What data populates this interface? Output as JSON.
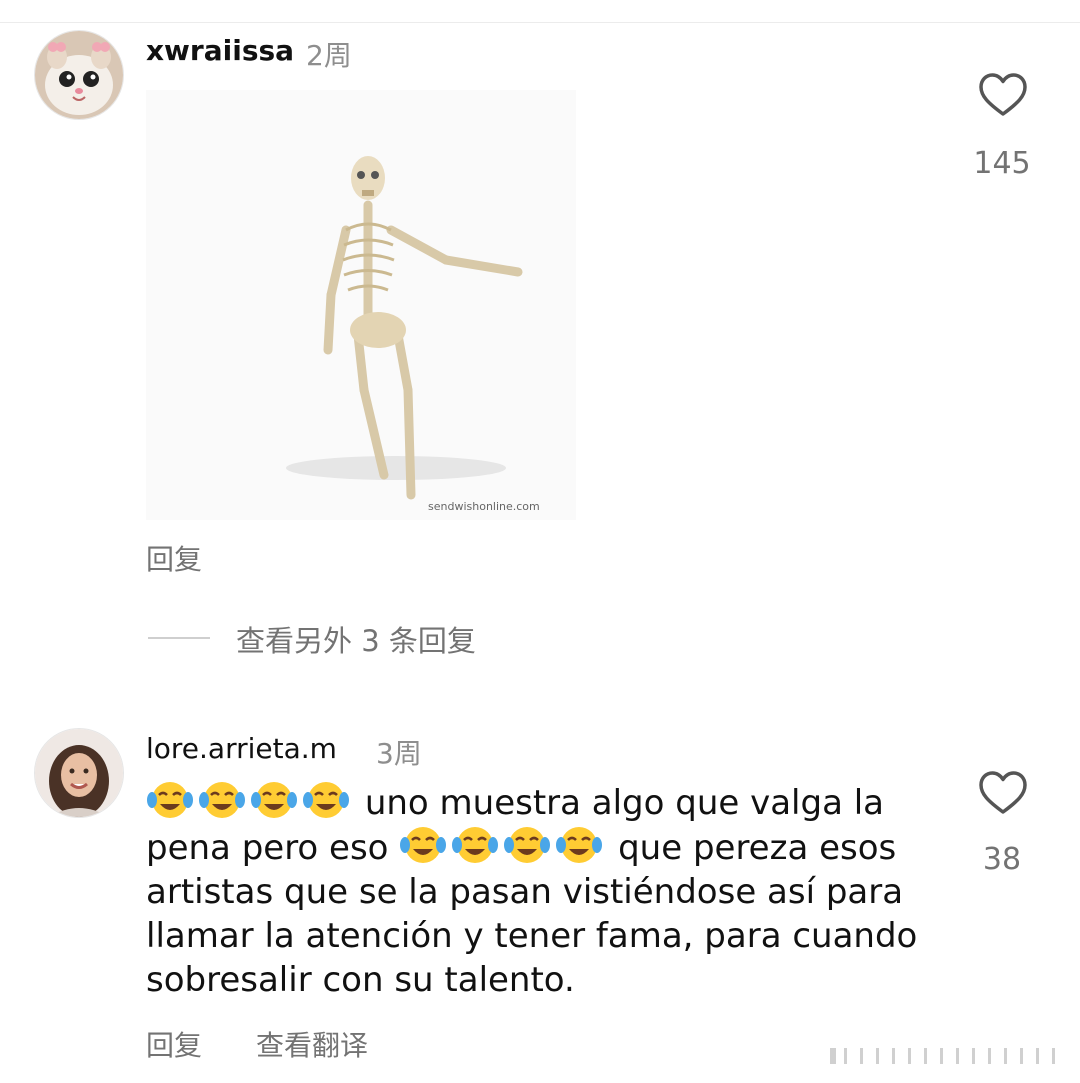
{
  "comments": [
    {
      "username": "xwraiissa",
      "time": "2周",
      "reply_label": "回复",
      "likes": "145",
      "gif_watermark": "sendwishonline.com",
      "view_more_replies": "查看另外 3 条回复"
    },
    {
      "username": "lore.arrieta.m",
      "time": "3周",
      "text_part1": "uno muestra algo que valga la pena pero eso",
      "text_part2": "que pereza esos artistas que se la pasan vistiéndose así para llamar la atención y tener fama, para cuando sobresalir con su talento.",
      "reply_label": "回复",
      "translate_label": "查看翻译",
      "likes": "38"
    }
  ],
  "icons": {
    "like": "heart-outline-icon",
    "emoji": "face-with-tears-of-joy-emoji"
  },
  "colors": {
    "primary_text": "#111111",
    "secondary_text": "#737373",
    "time_text": "#8e8e8e"
  }
}
